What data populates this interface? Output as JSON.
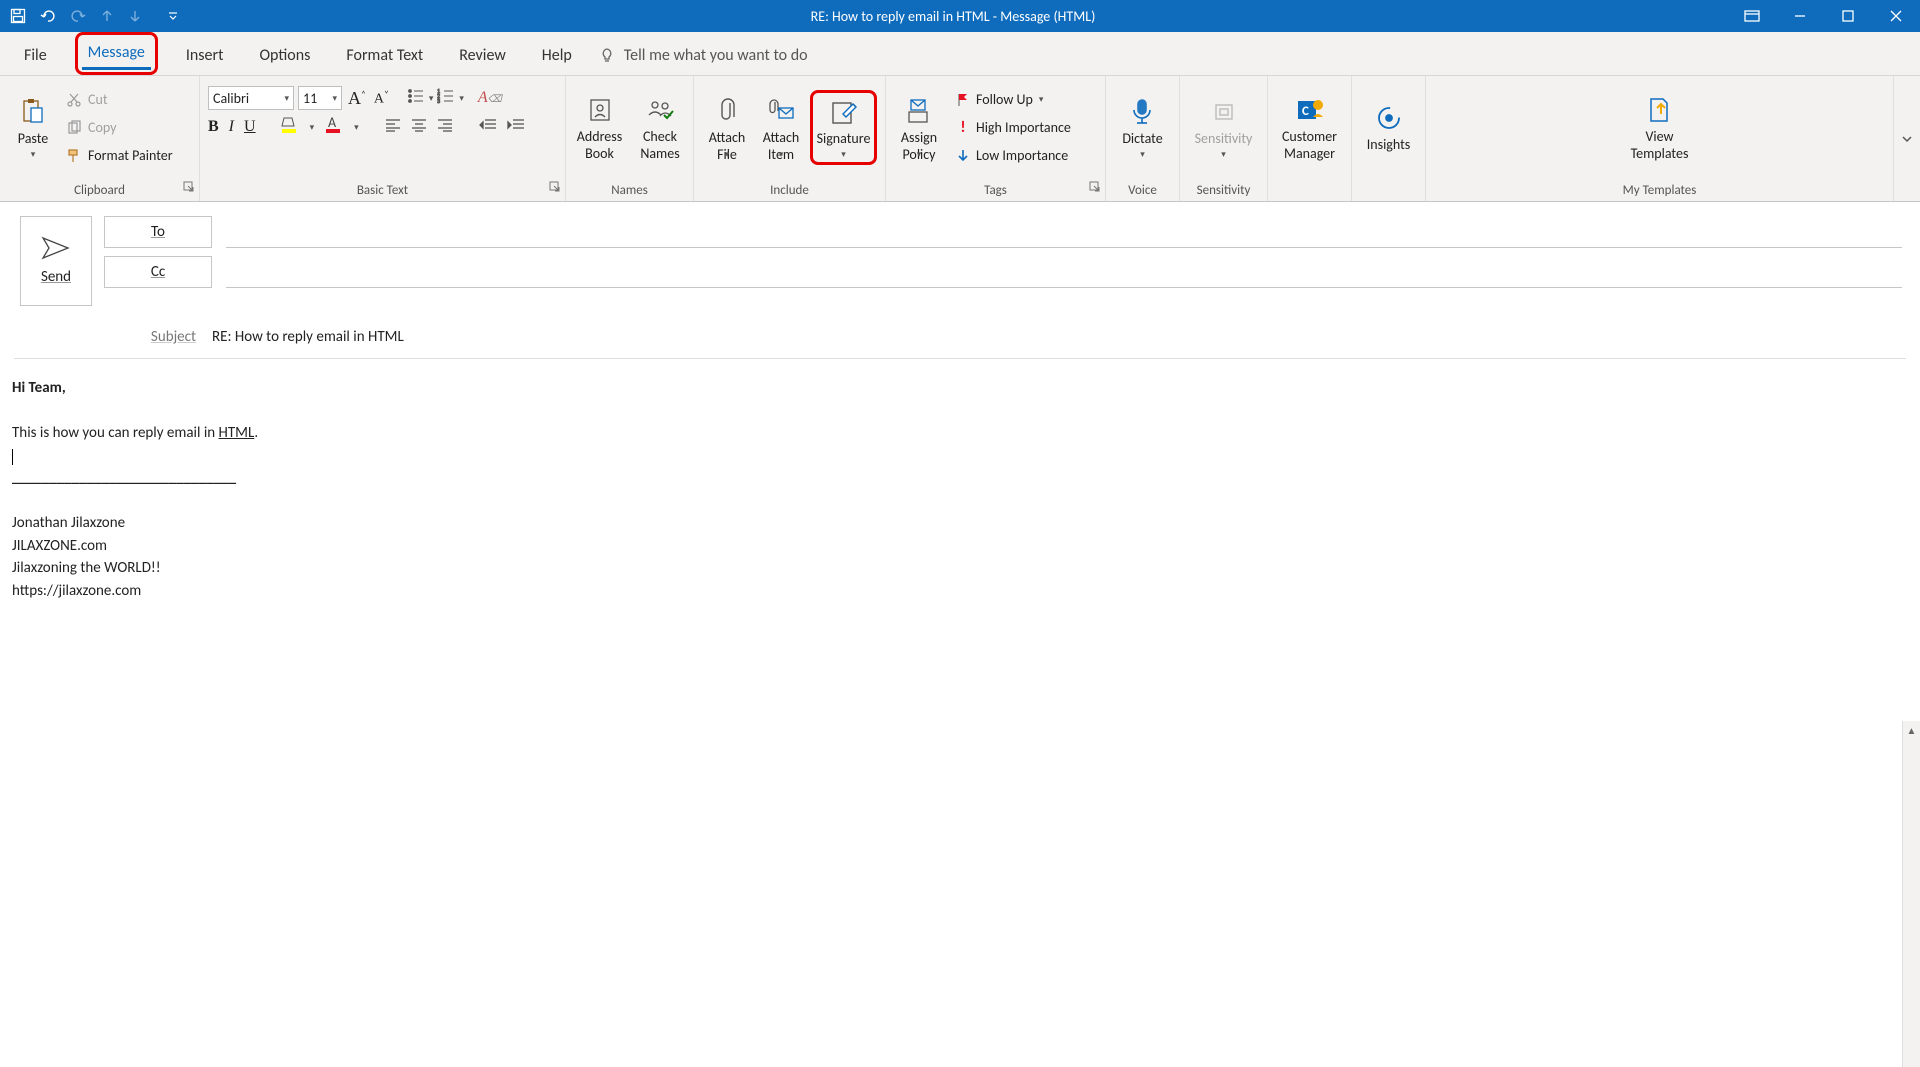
{
  "titlebar": {
    "title": "RE: How to reply email in HTML  -  Message (HTML)"
  },
  "tabs": {
    "file": "File",
    "message": "Message",
    "insert": "Insert",
    "options": "Options",
    "format_text": "Format Text",
    "review": "Review",
    "help": "Help",
    "tell_me": "Tell me what you want to do"
  },
  "ribbon": {
    "clipboard": {
      "paste": "Paste",
      "cut": "Cut",
      "copy": "Copy",
      "format_painter": "Format Painter",
      "label": "Clipboard"
    },
    "basic_text": {
      "font_name": "Calibri",
      "font_size": "11",
      "label": "Basic Text"
    },
    "names": {
      "address_book": "Address\nBook",
      "check_names": "Check\nNames",
      "label": "Names"
    },
    "include": {
      "attach_file": "Attach\nFile",
      "attach_item": "Attach\nItem",
      "signature": "Signature",
      "label": "Include"
    },
    "tags": {
      "assign_policy": "Assign\nPolicy",
      "follow_up": "Follow Up",
      "high_importance": "High Importance",
      "low_importance": "Low Importance",
      "label": "Tags"
    },
    "voice": {
      "dictate": "Dictate",
      "label": "Voice"
    },
    "sensitivity": {
      "btn": "Sensitivity",
      "label": "Sensitivity"
    },
    "customer": {
      "btn": "Customer\nManager"
    },
    "insights": {
      "btn": "Insights"
    },
    "templates": {
      "btn": "View\nTemplates",
      "label": "My Templates"
    }
  },
  "compose": {
    "send": "Send",
    "to": "To",
    "cc": "Cc",
    "subject_label": "Subject",
    "subject_value": "RE: How to reply email in HTML"
  },
  "body": {
    "greeting": "Hi Team,",
    "line1_a": "This is how you can reply email in ",
    "line1_b": "HTML",
    "line1_c": ".",
    "separator": "______________________________",
    "sig1": "Jonathan Jilaxzone",
    "sig2": "JILAXZONE.com",
    "sig3": "Jilaxzoning the WORLD!!",
    "sig4": "https://jilaxzone.com"
  }
}
